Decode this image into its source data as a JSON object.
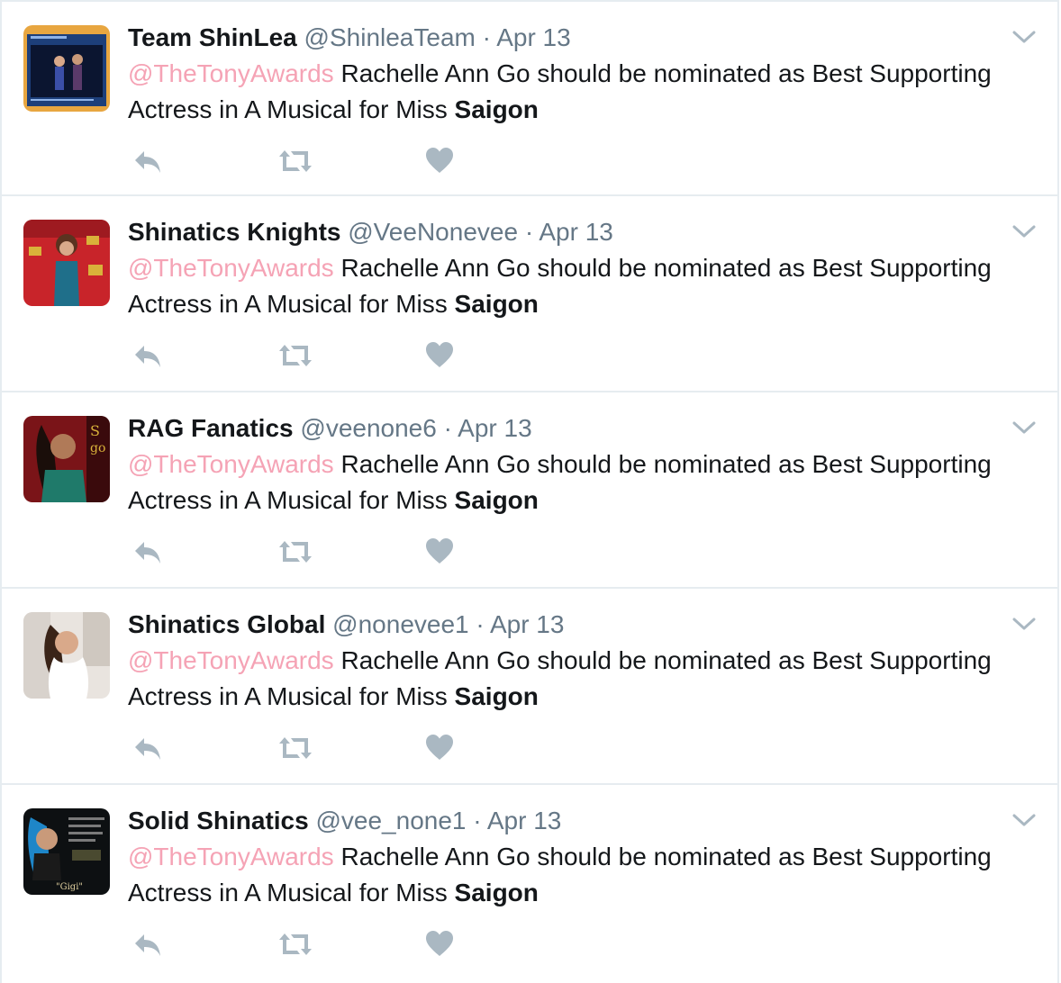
{
  "colors": {
    "mention": "#f5a3b5",
    "secondary_text": "#657786",
    "action_icon": "#aab8c2",
    "border": "#e6ecf0"
  },
  "tweets": [
    {
      "name": "Team ShinLea",
      "handle": "@ShinleaTeam",
      "separator": "·",
      "time": "Apr 13",
      "mention": "@TheTonyAwards",
      "text": " Rachelle Ann Go should be nominated as Best Supporting Actress in A Musical for Miss ",
      "bold": "Saigon",
      "avatar_icon": "stage-photo-avatar"
    },
    {
      "name": "Shinatics Knights",
      "handle": "@VeeNonevee",
      "separator": "·",
      "time": "Apr 13",
      "mention": "@TheTonyAwards",
      "text": " Rachelle Ann Go should be nominated as Best Supporting Actress in A Musical for Miss ",
      "bold": "Saigon",
      "avatar_icon": "red-carpet-avatar"
    },
    {
      "name": "RAG Fanatics",
      "handle": "@veenone6",
      "separator": "·",
      "time": "Apr 13",
      "mention": "@TheTonyAwards",
      "text": " Rachelle Ann Go should be nominated as Best Supporting Actress in A Musical for Miss ",
      "bold": "Saigon",
      "avatar_icon": "portrait-avatar"
    },
    {
      "name": "Shinatics Global",
      "handle": "@nonevee1",
      "separator": "·",
      "time": "Apr 13",
      "mention": "@TheTonyAwards",
      "text": " Rachelle Ann Go should be nominated as Best Supporting Actress in A Musical for Miss ",
      "bold": "Saigon",
      "avatar_icon": "bright-portrait-avatar"
    },
    {
      "name": "Solid Shinatics",
      "handle": "@vee_none1",
      "separator": "·",
      "time": "Apr 13",
      "mention": "@TheTonyAwards",
      "text": " Rachelle Ann Go should be nominated as Best Supporting Actress in A Musical for Miss ",
      "bold": "Saigon",
      "avatar_icon": "poster-avatar"
    }
  ],
  "actions": {
    "reply_icon": "reply-icon",
    "retweet_icon": "retweet-icon",
    "like_icon": "heart-icon",
    "menu_icon": "chevron-down-icon"
  }
}
